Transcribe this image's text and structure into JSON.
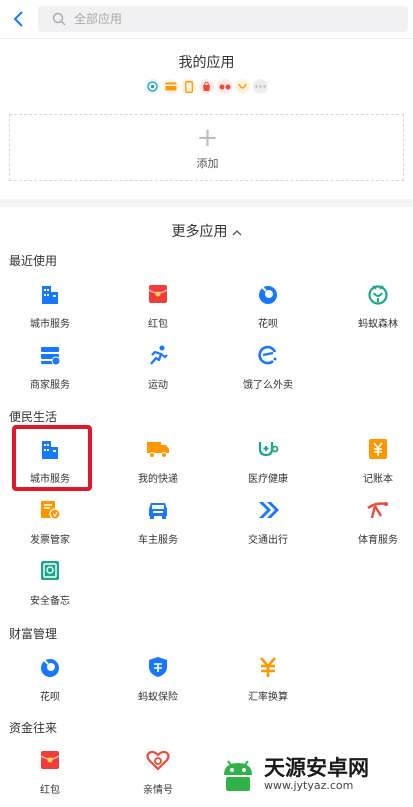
{
  "search": {
    "placeholder": "全部应用"
  },
  "my_apps": {
    "title": "我的应用",
    "add_label": "添加"
  },
  "more_apps": {
    "title": "更多应用"
  },
  "sections": [
    {
      "title": "最近使用",
      "apps": [
        {
          "label": "城市服务",
          "icon": "city-icon"
        },
        {
          "label": "红包",
          "icon": "red-packet-icon"
        },
        {
          "label": "花呗",
          "icon": "huabei-icon"
        },
        {
          "label": "蚂蚁森林",
          "icon": "forest-icon"
        },
        {
          "label": "商家服务",
          "icon": "merchant-icon"
        },
        {
          "label": "运动",
          "icon": "sport-icon"
        },
        {
          "label": "饿了么外卖",
          "icon": "eleme-icon"
        }
      ]
    },
    {
      "title": "便民生活",
      "apps": [
        {
          "label": "城市服务",
          "icon": "city-icon"
        },
        {
          "label": "我的快递",
          "icon": "truck-icon"
        },
        {
          "label": "医疗健康",
          "icon": "health-icon"
        },
        {
          "label": "记账本",
          "icon": "ledger-icon"
        },
        {
          "label": "发票管家",
          "icon": "invoice-icon"
        },
        {
          "label": "车主服务",
          "icon": "car-icon"
        },
        {
          "label": "交通出行",
          "icon": "transport-icon"
        },
        {
          "label": "体育服务",
          "icon": "sports-service-icon"
        },
        {
          "label": "安全备忘",
          "icon": "safe-icon"
        }
      ]
    },
    {
      "title": "财富管理",
      "apps": [
        {
          "label": "花呗",
          "icon": "huabei-icon"
        },
        {
          "label": "蚂蚁保险",
          "icon": "insurance-icon"
        },
        {
          "label": "汇率换算",
          "icon": "exchange-icon"
        }
      ]
    },
    {
      "title": "资金往来",
      "apps": [
        {
          "label": "红包",
          "icon": "red-packet-icon"
        },
        {
          "label": "亲情号",
          "icon": "family-icon"
        }
      ]
    }
  ],
  "watermark": {
    "text": "天源安卓网",
    "url": "www.jytyaz.com"
  },
  "colors": {
    "blue": "#1677ff",
    "orange": "#ff8a00",
    "red": "#f23c3c",
    "teal": "#1aa68b",
    "highlight": "#e0182a"
  }
}
